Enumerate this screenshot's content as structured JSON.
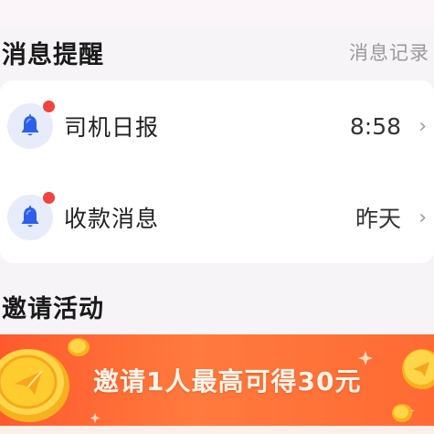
{
  "messages_section": {
    "title": "消息提醒",
    "history_link": "消息记录"
  },
  "messages": [
    {
      "label": "司机日报",
      "time": "8:58",
      "icon": "bell-icon",
      "unread": true
    },
    {
      "label": "收款消息",
      "time": "昨天",
      "icon": "bell-icon",
      "unread": true
    }
  ],
  "invite_section": {
    "title": "邀请活动"
  },
  "banner": {
    "text": "邀请1人最高可得30元",
    "icon_left": "paper-plane-coin-icon",
    "icon_right": "paper-plane-coin-icon"
  },
  "colors": {
    "accent_orange": "#ff6a33",
    "unread_dot": "#f2433f",
    "bell_blue": "#2f5fe8"
  }
}
